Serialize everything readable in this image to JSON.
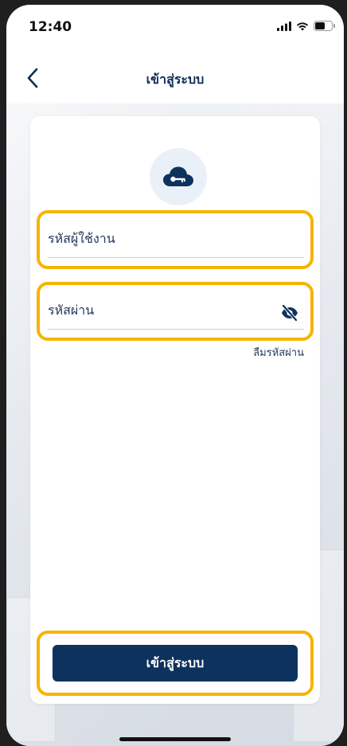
{
  "status_bar": {
    "time": "12:40"
  },
  "nav": {
    "title": "เข้าสู่ระบบ"
  },
  "form": {
    "username_placeholder": "รหัสผู้ใช้งาน",
    "password_placeholder": "รหัสผ่าน",
    "forgot_password": "ลืมรหัสผ่าน",
    "submit_label": "เข้าสู่ระบบ"
  },
  "icons": {
    "back": "chevron-left-icon",
    "logo": "cloud-key-icon",
    "password_visibility": "eye-off-icon",
    "signal": "signal-icon",
    "wifi": "wifi-icon",
    "battery": "battery-icon"
  },
  "colors": {
    "primary": "#0e325e",
    "highlight": "#f5b400",
    "text": "#233a5e"
  }
}
